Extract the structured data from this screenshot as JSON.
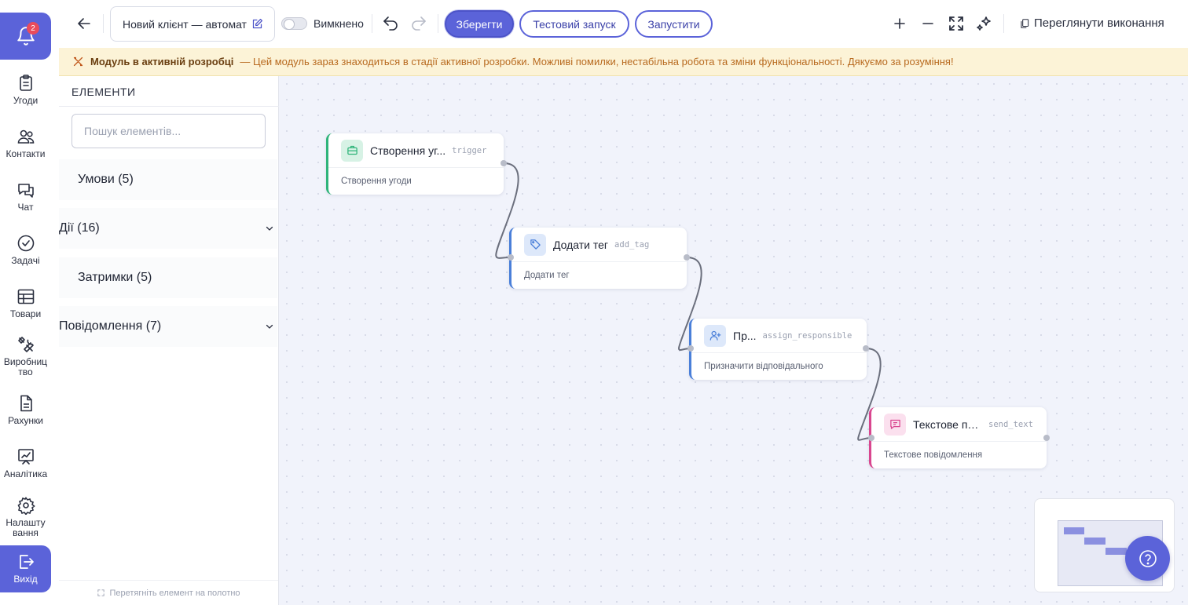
{
  "nav": {
    "notification_count": "2",
    "items": [
      {
        "label": "Угоди",
        "icon": "clipboard-icon"
      },
      {
        "label": "Контакти",
        "icon": "users-icon"
      },
      {
        "label": "Чат",
        "icon": "chat-icon"
      },
      {
        "label": "Задачі",
        "icon": "check-circle-icon"
      },
      {
        "label": "Товари",
        "icon": "table-icon"
      },
      {
        "label_line1": "Виробниц",
        "label_line2": "тво",
        "icon": "tools-icon"
      },
      {
        "label": "Рахунки",
        "icon": "document-icon"
      },
      {
        "label": "Аналітика",
        "icon": "analytics-icon"
      },
      {
        "label_line1": "Налашту",
        "label_line2": "вання",
        "icon": "gear-icon"
      }
    ],
    "exit_label": "Вихід"
  },
  "toolbar": {
    "title": "Новий клієнт — автоматизація",
    "toggle_label": "Вимкнено",
    "save_label": "Зберегти",
    "test_label": "Тестовий запуск",
    "run_label": "Запустити",
    "view_executions_label": "Переглянути виконання"
  },
  "banner": {
    "title": "Модуль в активній розробці",
    "text": "— Цей модуль зараз знаходиться в стадії активної розробки. Можливі помилки, нестабільна робота та зміни функціональності. Дякуємо за розуміння!"
  },
  "sidebar": {
    "header": "ЕЛЕМЕНТИ",
    "search_placeholder": "Пошук елементів...",
    "categories": [
      {
        "label": "Умови (5)",
        "expanded": false
      },
      {
        "label": "Дії (16)",
        "expanded": true
      },
      {
        "label": "Затримки (5)",
        "expanded": false
      },
      {
        "label": "Повідомлення (7)",
        "expanded": true
      }
    ],
    "footer": "Перетягніть елемент на полотно"
  },
  "canvas": {
    "nodes": [
      {
        "title": "Створення уг...",
        "code": "trigger",
        "description": "Створення угоди",
        "color": "#2fb47a",
        "icon": "briefcase-icon"
      },
      {
        "title": "Додати тег",
        "code": "add_tag",
        "description": "Додати тег",
        "color": "#4a7fd9",
        "icon": "tag-icon"
      },
      {
        "title": "Пр...",
        "code": "assign_responsible",
        "description": "Призначити відповідального",
        "color": "#4a7fd9",
        "icon": "user-plus-icon"
      },
      {
        "title": "Текстове по...",
        "code": "send_text",
        "description": "Текстове повідомлення",
        "color": "#d9468f",
        "icon": "message-icon"
      }
    ]
  },
  "colors": {
    "accent": "#5b63d9",
    "banner_bg": "#fcf3d7",
    "trigger": "#2fb47a",
    "action": "#4a7fd9",
    "message": "#d9468f"
  }
}
